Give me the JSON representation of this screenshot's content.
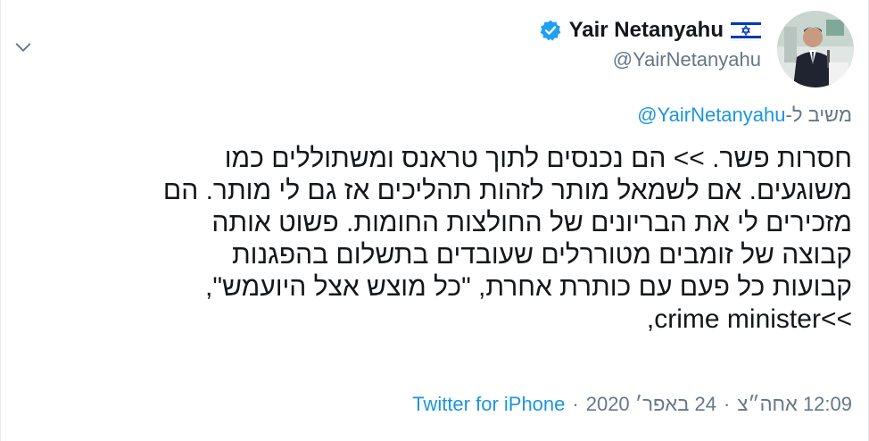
{
  "author": {
    "display_name": "Yair Netanyahu",
    "handle": "@YairNetanyahu",
    "verified": true
  },
  "reply": {
    "prefix": "משיב ל-",
    "target": "@YairNetanyahu"
  },
  "tweet": {
    "text": "חסרות פשר. >>    הם נכנסים לתוך טראנס ומשתוללים כמו\nמשוגעים.  אם לשמאל מותר לזהות תהליכים אז גם לי מותר. הם\nמזכירים לי את הבריונים של החולצות החומות. פשוט אותה\nקבוצה של זומבים מטוררלים שעובדים בתשלום בהפגנות\nקבועות כל פעם עם כותרת אחרת, \"כל מוצש אצל היועמש\",\n>>crime minister,"
  },
  "footer": {
    "time": "12:09 אחה״צ",
    "date": "24 באפר׳ 2020",
    "separator": "·",
    "source": "Twitter for iPhone"
  },
  "colors": {
    "link": "#1b95e0",
    "secondary_text": "#657786",
    "verified_badge": "#1da1f2",
    "primary_text": "#14171a"
  },
  "icons": {
    "caret": "chevron-down-icon",
    "verified": "verified-badge-icon",
    "flag": "israel-flag-icon"
  }
}
